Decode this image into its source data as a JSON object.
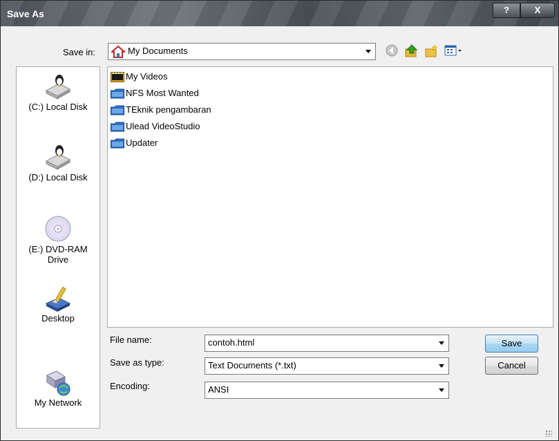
{
  "window": {
    "title": "Save As",
    "help_label": "?",
    "close_label": "X"
  },
  "toolbar": {
    "save_in_label": "Save in:",
    "save_in_value": "My Documents",
    "icons": [
      "back-icon",
      "up-folder-icon",
      "new-folder-icon",
      "views-menu-icon"
    ]
  },
  "places": [
    {
      "label": "(C:) Local Disk",
      "icon": "local-disk-icon"
    },
    {
      "label": "(D:) Local Disk",
      "icon": "local-disk-icon"
    },
    {
      "label": "(E:) DVD-RAM Drive",
      "line1": "(E:) DVD-RAM",
      "line2": "Drive",
      "icon": "dvd-drive-icon"
    },
    {
      "label": "Desktop",
      "icon": "desktop-icon"
    },
    {
      "label": "My Network",
      "icon": "network-icon"
    }
  ],
  "files": [
    {
      "name": "My Videos",
      "icon": "video-folder-icon"
    },
    {
      "name": "NFS Most Wanted",
      "icon": "folder-icon"
    },
    {
      "name": "TEknik pengambaran",
      "icon": "folder-icon"
    },
    {
      "name": "Ulead VideoStudio",
      "icon": "folder-icon"
    },
    {
      "name": "Updater",
      "icon": "folder-icon"
    }
  ],
  "form": {
    "file_name_label": "File name:",
    "file_name_value": "contoh.html",
    "save_type_label": "Save as type:",
    "save_type_value": "Text Documents (*.txt)",
    "encoding_label": "Encoding:",
    "encoding_value": "ANSI"
  },
  "buttons": {
    "save": "Save",
    "cancel": "Cancel"
  },
  "colors": {
    "folder": "#2d6fc4",
    "titlebar": "#5a6166",
    "default_button": "#a9d7f3"
  }
}
